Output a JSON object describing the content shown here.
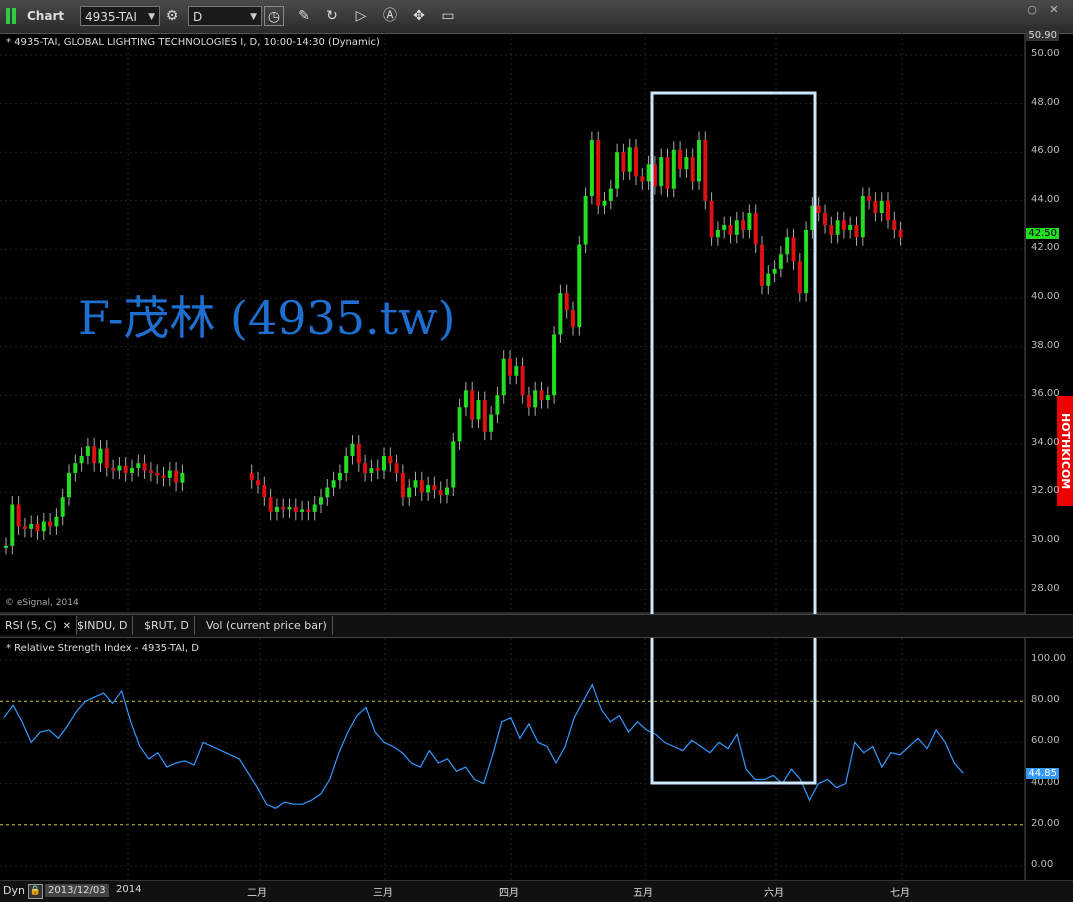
{
  "toolbar": {
    "title": "Chart",
    "symbol": "4935-TAI",
    "interval": "D"
  },
  "main_chart": {
    "legend": "* 4935-TAI, GLOBAL LIGHTING TECHNOLOGIES I, D, 10:00-14:30 (Dynamic)",
    "copyright": "© eSignal, 2014",
    "watermark": "F-茂林 (4935.tw)",
    "side_label": "HOTHKICOM",
    "top_price": "50.90",
    "last_price": "42.50",
    "price_ticks": [
      "50.00",
      "48.00",
      "46.00",
      "44.00",
      "42.00",
      "40.00",
      "38.00",
      "36.00",
      "34.00",
      "32.00",
      "30.00",
      "28.00"
    ]
  },
  "tabs": [
    {
      "label": "RSI (5, C)",
      "active": true
    },
    {
      "label": "$INDU, D",
      "active": false
    },
    {
      "label": "$RUT, D",
      "active": false
    },
    {
      "label": "Vol (current price bar)",
      "active": false
    }
  ],
  "rsi": {
    "legend": "* Relative Strength Index - 4935-TAI, D",
    "ticks": [
      "100.00",
      "80.00",
      "60.00",
      "40.00",
      "20.00",
      "0.00"
    ],
    "last_value": "44.85"
  },
  "bottom": {
    "mode": "Dyn",
    "start_date": "2013/12/03",
    "months": [
      "2014",
      "二月",
      "三月",
      "四月",
      "五月",
      "六月",
      "七月"
    ]
  },
  "colors": {
    "up": "#22dd22",
    "down": "#dd1111",
    "rsi_line": "#3399ff",
    "highlight": "#cce8ff",
    "watermark": "#1f6fd0"
  }
}
